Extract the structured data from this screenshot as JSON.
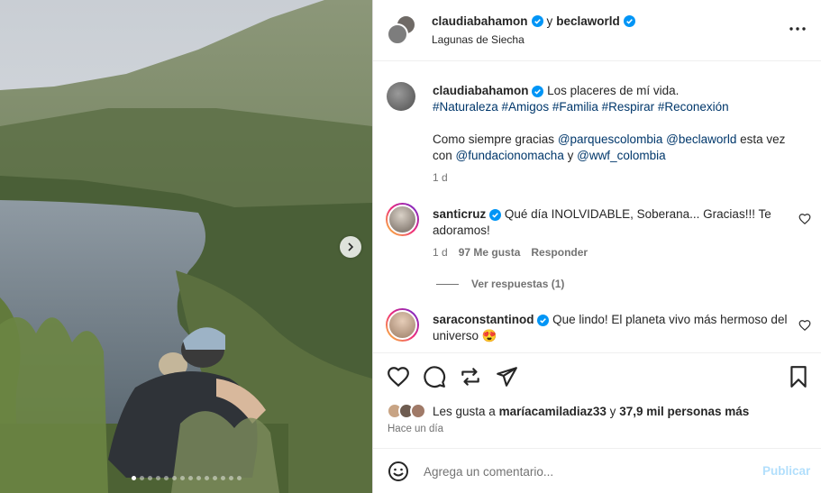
{
  "carousel": {
    "slide_count": 14,
    "active_index": 0
  },
  "header": {
    "user1": "claudiabahamon",
    "connector": "y",
    "user2": "beclaworld",
    "location": "Lagunas de Siecha"
  },
  "caption": {
    "username": "claudiabahamon",
    "text": "Los placeres de mí vida.",
    "hashtags": "#Naturaleza #Amigos #Familia #Respirar #Reconexión",
    "line2_prefix": "Como siempre gracias",
    "mention1": "@parquescolombia",
    "mention2": "@beclaworld",
    "line2_mid": "esta vez con",
    "mention3": "@fundacionomacha",
    "line2_and": "y",
    "mention4": "@wwf_colombia",
    "time": "1 d"
  },
  "comments": [
    {
      "username": "santicruz",
      "text": "Qué día INOLVIDABLE, Soberana... Gracias!!! Te adoramos!",
      "time": "1 d",
      "likes": "97 Me gusta",
      "reply_label": "Responder",
      "view_replies": "Ver respuestas (1)"
    },
    {
      "username": "saraconstantinod",
      "text": "Que lindo! El planeta vivo más hermoso del universo",
      "emoji": "😍"
    }
  ],
  "likes": {
    "prefix": "Les gusta a",
    "user": "maríacamiladiaz33",
    "middle": "y",
    "others": "37,9 mil personas más"
  },
  "time_ago": "Hace un día",
  "add_comment": {
    "placeholder": "Agrega un comentario...",
    "publish_label": "Publicar"
  },
  "colors": {
    "link": "#00376b",
    "verified": "#0095f6",
    "publish_disabled": "#b2dffc",
    "muted": "#737373"
  }
}
